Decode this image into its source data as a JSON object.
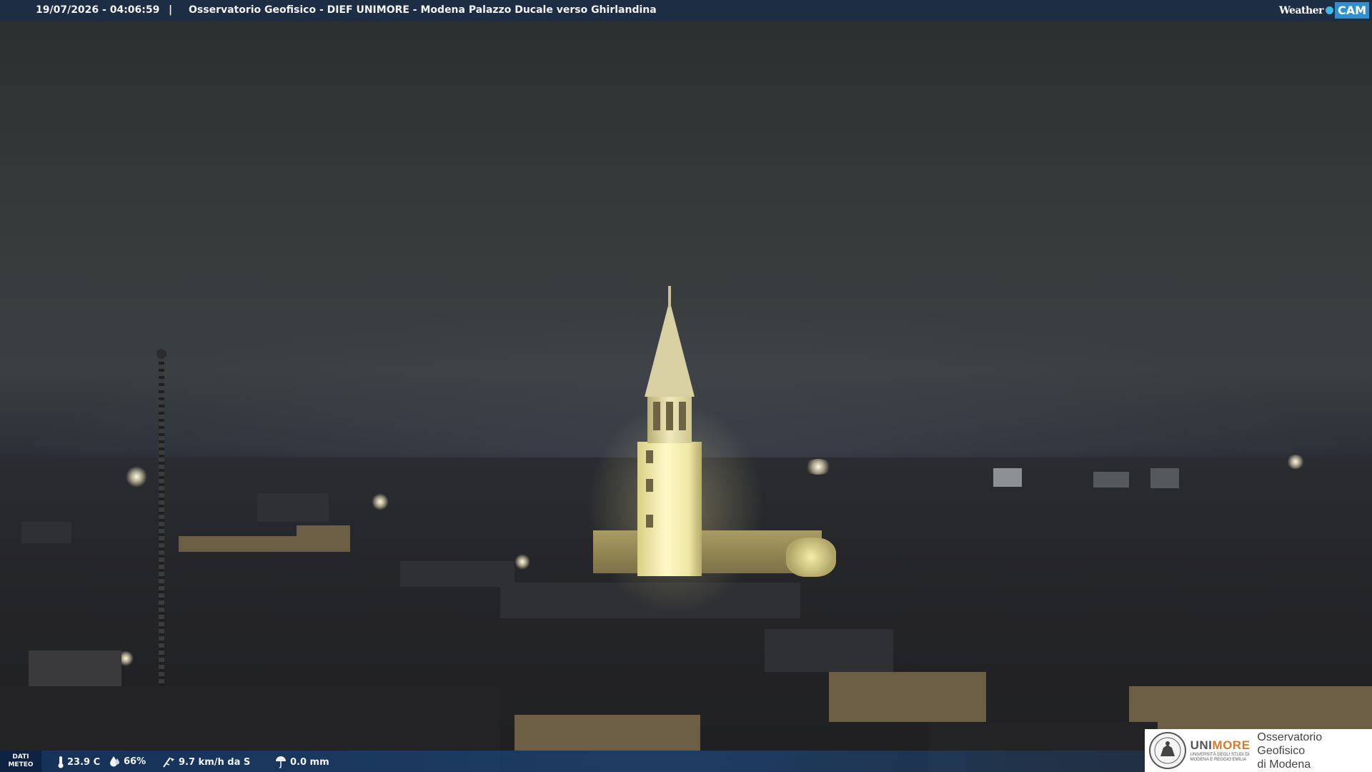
{
  "header": {
    "timestamp": "19/07/2026 - 04:06:59",
    "separator": "|",
    "location": "Osservatorio Geofisico - DIEF UNIMORE - Modena Palazzo Ducale verso Ghirlandina",
    "brand_word": "Weather",
    "brand_cam": "CAM"
  },
  "weather": {
    "section_label_line1": "DATI",
    "section_label_line2": "METEO",
    "temperature": "23.9 C",
    "humidity": "66%",
    "wind": "9.7 km/h da S",
    "rain": "0.0 mm"
  },
  "logo": {
    "uni": "UNI",
    "more": "MORE",
    "sub_line1": "UNIVERSITÀ DEGLI STUDI DI",
    "sub_line2": "MODENA E REGGIO EMILIA",
    "observatory_line1": "Osservatorio Geofisico",
    "observatory_line2": "di Modena"
  },
  "colors": {
    "topbar": "#1c2d46",
    "bottombar": "#16325a",
    "brand_accent": "#2f8fcf",
    "unimore_accent": "#d87a2a"
  },
  "icons": [
    "thermometer-icon",
    "humidity-drop-icon",
    "wind-icon",
    "rain-gauge-icon",
    "university-seal-icon"
  ]
}
